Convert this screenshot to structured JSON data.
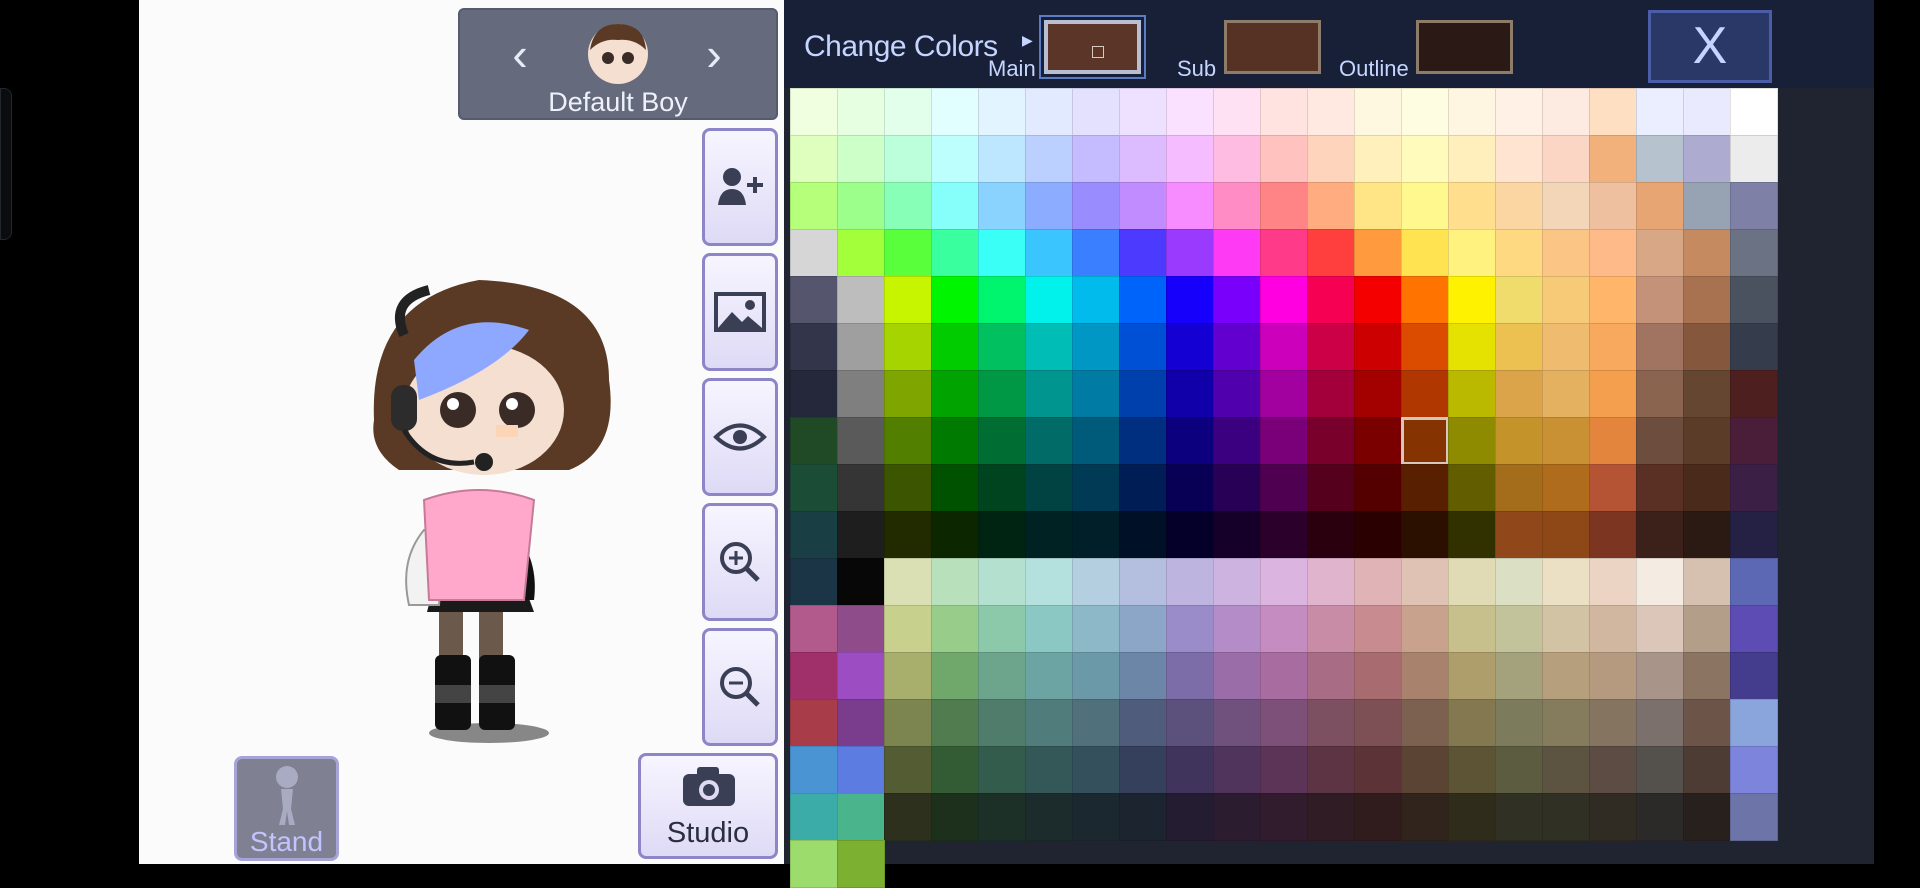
{
  "character_nav": {
    "name": "Default Boy",
    "prev_icon": "chevron-left-icon",
    "next_icon": "chevron-right-icon"
  },
  "side_buttons": [
    {
      "name": "add-character",
      "icon": "add-user-icon"
    },
    {
      "name": "background",
      "icon": "image-icon"
    },
    {
      "name": "visibility",
      "icon": "eye-icon"
    },
    {
      "name": "zoom-in",
      "icon": "zoom-in-icon"
    },
    {
      "name": "zoom-out",
      "icon": "zoom-out-icon"
    }
  ],
  "bottom": {
    "stand_label": "Stand",
    "studio_label": "Studio"
  },
  "panel": {
    "title": "Change Colors",
    "main_label": "Main",
    "sub_label": "Sub",
    "outline_label": "Outline",
    "close_label": "X",
    "main_color": "#5a3528",
    "sub_color": "#553223",
    "outline_color": "#2a1915",
    "selected_index": 160
  },
  "palette": [
    "#f1ffe1",
    "#e7ffe1",
    "#e1ffea",
    "#e1fffe",
    "#e1f4ff",
    "#e1eaff",
    "#e4e1ff",
    "#eee1ff",
    "#fae1ff",
    "#ffe1f4",
    "#ffe3e1",
    "#ffe9e1",
    "#fff8e1",
    "#fffde1",
    "#fff6e1",
    "#fff1e5",
    "#fdebe1",
    "#ffdfc2",
    "#eaeeff",
    "#eaeaff",
    "#ffffff",
    "#dfffbf",
    "#cdffc9",
    "#bcffdb",
    "#bcfffd",
    "#bde6ff",
    "#bcd0ff",
    "#c5bcff",
    "#dcbcff",
    "#f5bcff",
    "#ffbce3",
    "#ffc2bf",
    "#ffd4bc",
    "#fff0bc",
    "#fffbbc",
    "#ffefbc",
    "#ffe4d1",
    "#fbd6c5",
    "#f2b07a",
    "#b7c2cf",
    "#adabd0",
    "#ececec",
    "#b5ff7a",
    "#9cff8c",
    "#88ffb7",
    "#86fffb",
    "#8ad3ff",
    "#8cadff",
    "#998cff",
    "#c08cff",
    "#f68cff",
    "#ff8cc4",
    "#ff8486",
    "#ffac80",
    "#ffe585",
    "#fff88e",
    "#ffdf8d",
    "#fbd5a2",
    "#f3d5b8",
    "#eec0a0",
    "#e6a572",
    "#97a3b3",
    "#7e80a6",
    "#d6d6d6",
    "#a3ff3a",
    "#59ff3a",
    "#3aff9e",
    "#3afff6",
    "#3ac5ff",
    "#3a7fff",
    "#4d3aff",
    "#9a3aff",
    "#ff3af5",
    "#ff3a88",
    "#ff3e3e",
    "#ff9a3e",
    "#ffe350",
    "#fff27e",
    "#ffd981",
    "#fbc585",
    "#ffba8a",
    "#d8a886",
    "#c58a60",
    "#6a7284",
    "#55566e",
    "#bdbdbd",
    "#c7f500",
    "#00f600",
    "#00f56f",
    "#00f2ea",
    "#00bbec",
    "#0063fa",
    "#1600fb",
    "#7900fb",
    "#ff00e1",
    "#f50052",
    "#f50000",
    "#ff7300",
    "#fff200",
    "#f0dc6c",
    "#f7ca78",
    "#ffb56a",
    "#c49278",
    "#a87150",
    "#4a515f",
    "#33354a",
    "#9f9f9f",
    "#a6d400",
    "#00cc00",
    "#00c05f",
    "#00bdb5",
    "#0097c4",
    "#0050d5",
    "#1500d3",
    "#6100cf",
    "#cc00bb",
    "#cc0047",
    "#cc0000",
    "#db4c00",
    "#e5e100",
    "#edc151",
    "#efbc6f",
    "#f9a95e",
    "#a07461",
    "#85583e",
    "#353d4d",
    "#25273a",
    "#7f7f7f",
    "#7fa600",
    "#00a300",
    "#009844",
    "#00968f",
    "#007ba3",
    "#0040ac",
    "#1100aa",
    "#5000ac",
    "#a300a0",
    "#a3003b",
    "#a30000",
    "#b13700",
    "#bbb800",
    "#dca44a",
    "#e3b15f",
    "#f49f4e",
    "#8a644f",
    "#654630",
    "#4d1f1f",
    "#1f4a25",
    "#5a5a5a",
    "#527f00",
    "#007a00",
    "#006d33",
    "#006b67",
    "#005a7a",
    "#002f7f",
    "#0c007f",
    "#3b007f",
    "#7a007a",
    "#7a002c",
    "#7a0000",
    "#853300",
    "#8f8b00",
    "#c4942b",
    "#c99134",
    "#e4853d",
    "#6c4d3e",
    "#5a3c29",
    "#4a1d38",
    "#1b4d36",
    "#353535",
    "#3c5500",
    "#005200",
    "#00441f",
    "#004342",
    "#003a55",
    "#001d55",
    "#080055",
    "#280055",
    "#500050",
    "#55001d",
    "#550000",
    "#582000",
    "#625e00",
    "#a36d1b",
    "#ae6c1c",
    "#b55434",
    "#5a2f24",
    "#4a2a1a",
    "#3c1f45",
    "#193e43",
    "#1e1e1e",
    "#222b00",
    "#0c2700",
    "#002412",
    "#002222",
    "#001f29",
    "#001026",
    "#04002a",
    "#15002a",
    "#2b002b",
    "#2a000e",
    "#2a0000",
    "#2b1000",
    "#313100",
    "#90481a",
    "#8e4716",
    "#7c3521",
    "#3b211a",
    "#2b1a14",
    "#252144",
    "#1b3547",
    "#070707",
    "#dbe0b4",
    "#b8e0bb",
    "#b4e0cf",
    "#b4e0de",
    "#b4d0e0",
    "#b4bfe0",
    "#bdb4e0",
    "#cdb4e0",
    "#dcb4e0",
    "#e0b4cc",
    "#e0b4b6",
    "#e0c2b4",
    "#e0dbb4",
    "#dbe0c4",
    "#ebe0c4",
    "#ebd4c4",
    "#f4ebe2",
    "#d6c0b0",
    "#5c68b4",
    "#b25a8b",
    "#8f4c8b",
    "#c8d08e",
    "#98cc8b",
    "#8cc9aa",
    "#8cc8c3",
    "#8cb8c8",
    "#8ca6c8",
    "#9a8cc8",
    "#b38cc8",
    "#c48cc0",
    "#c88ca6",
    "#c88c90",
    "#c8a28c",
    "#c8c08c",
    "#c2c39a",
    "#d2c3a4",
    "#d2b7a0",
    "#dcc6ba",
    "#b39e89",
    "#5c4cb4",
    "#a0306a",
    "#9c4dc2",
    "#a8ae6c",
    "#70a86c",
    "#6ca48c",
    "#6ca4a4",
    "#6c99a8",
    "#6c86a8",
    "#7c6ca8",
    "#9a6ca8",
    "#a86ca0",
    "#a86c84",
    "#a86c70",
    "#a8826c",
    "#ae9e6c",
    "#a4a27c",
    "#b69f7c",
    "#b69a80",
    "#a89488",
    "#8c7462",
    "#443c8c",
    "#a83c48",
    "#7a3c8c",
    "#7c8450",
    "#507c50",
    "#507c6c",
    "#507c7c",
    "#50707c",
    "#505c7c",
    "#5c507c",
    "#70507c",
    "#7c5078",
    "#7c5060",
    "#7c5054",
    "#7c6050",
    "#847850",
    "#7c7c5c",
    "#847c5c",
    "#847460",
    "#7c706c",
    "#6c5448",
    "#8aa4dc",
    "#4a94d4",
    "#5c7ce2",
    "#545c34",
    "#345c34",
    "#345c4c",
    "#345858",
    "#34505c",
    "#34405c",
    "#40345c",
    "#50345c",
    "#5c3458",
    "#5c3444",
    "#5c3438",
    "#5c4434",
    "#5c5434",
    "#5c5c40",
    "#5c5440",
    "#5c4c44",
    "#54504c",
    "#4c3c34",
    "#7c84dc",
    "#3caca8",
    "#4ab48c",
    "#2c301c",
    "#1c301c",
    "#1c3028",
    "#1c2c2c",
    "#1c2830",
    "#1c2430",
    "#241c30",
    "#2c1c30",
    "#301c2c",
    "#301c24",
    "#301c1c",
    "#30241c",
    "#302c1c",
    "#303024",
    "#303024",
    "#302c24",
    "#2c2a28",
    "#28201c",
    "#6c74a8",
    "#9cdc6c",
    "#7cb030"
  ]
}
